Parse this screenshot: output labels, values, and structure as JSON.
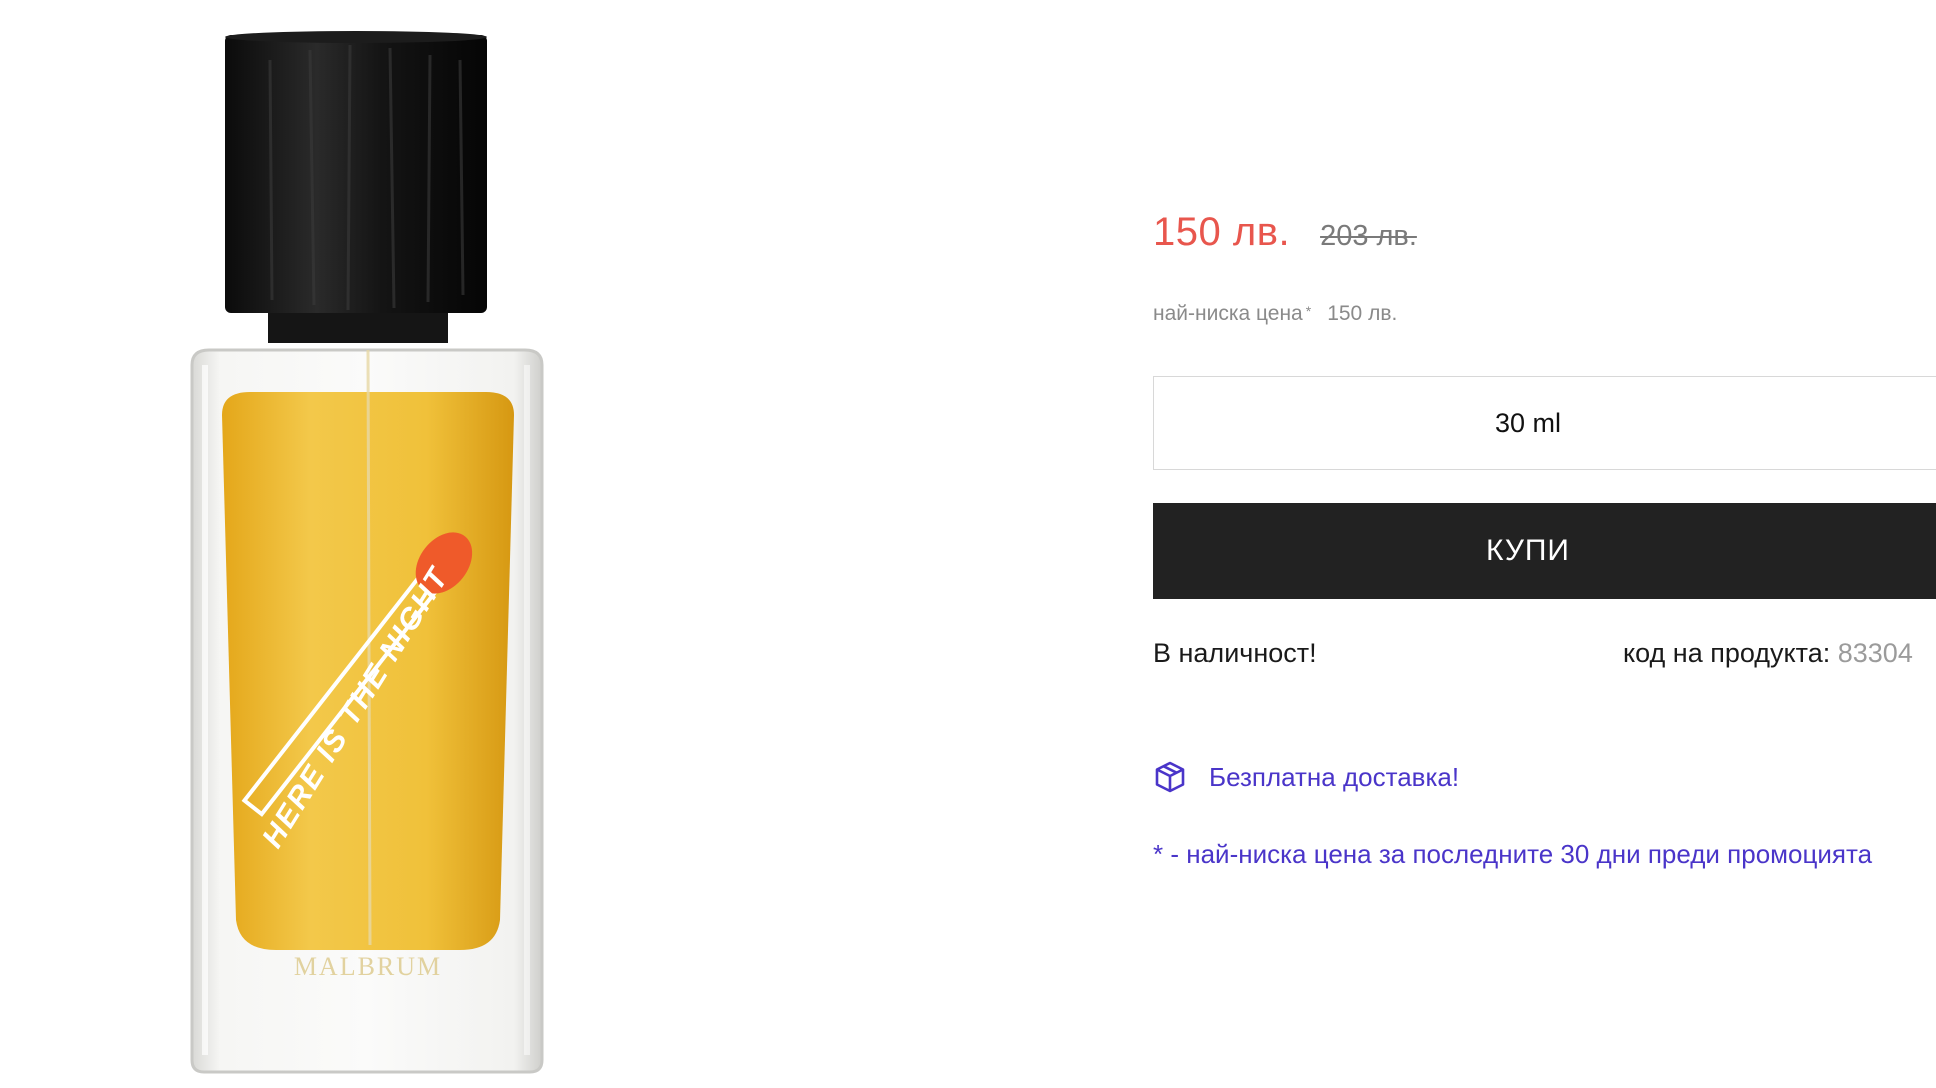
{
  "colors": {
    "sale_price": "#e8564d",
    "accent": "#4a35c9",
    "buy_button_bg": "#222222",
    "buy_button_text": "#ffffff"
  },
  "product": {
    "image": {
      "icon": "perfume-bottle-image",
      "bottle_text": "HERE IS THE NIGHT",
      "brand_mark": "MALBRUM"
    }
  },
  "pricing": {
    "current_price": "150 лв.",
    "old_price": "203 лв.",
    "lowest_label": "най-ниска цена",
    "lowest_marker": "*",
    "lowest_value": "150 лв."
  },
  "variant": {
    "selected_size": "30 ml"
  },
  "actions": {
    "buy_label": "КУПИ"
  },
  "availability": {
    "status": "В наличност!",
    "code_label": "код на продукта:",
    "code_value": "83304"
  },
  "delivery": {
    "icon": "box-icon",
    "label": "Безплатна доставка!"
  },
  "footnote": {
    "text": "* - най-ниска цена за последните 30 дни преди промоцията"
  }
}
